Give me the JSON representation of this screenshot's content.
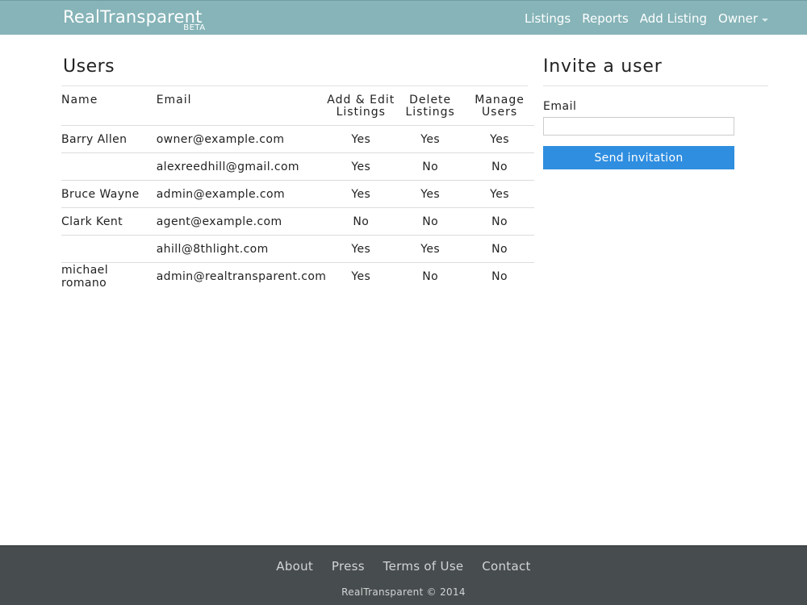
{
  "navbar": {
    "brand": "RealTransparent",
    "beta": "BETA",
    "links": [
      "Listings",
      "Reports",
      "Add Listing"
    ],
    "owner_menu": "Owner"
  },
  "users": {
    "title": "Users",
    "headers": {
      "name": "Name",
      "email": "Email",
      "add_edit_1": "Add & Edit",
      "add_edit_2": "Listings",
      "delete_1": "Delete",
      "delete_2": "Listings",
      "manage_1": "Manage",
      "manage_2": "Users"
    },
    "rows": [
      {
        "name": "Barry Allen",
        "email": "owner@example.com",
        "add_edit": "Yes",
        "delete": "Yes",
        "manage": "Yes"
      },
      {
        "name": "",
        "email": "alexreedhill@gmail.com",
        "add_edit": "Yes",
        "delete": "No",
        "manage": "No"
      },
      {
        "name": "Bruce Wayne",
        "email": "admin@example.com",
        "add_edit": "Yes",
        "delete": "Yes",
        "manage": "Yes"
      },
      {
        "name": "Clark Kent",
        "email": "agent@example.com",
        "add_edit": "No",
        "delete": "No",
        "manage": "No"
      },
      {
        "name": "",
        "email": "ahill@8thlight.com",
        "add_edit": "Yes",
        "delete": "Yes",
        "manage": "No"
      },
      {
        "name": "michael romano",
        "email": "admin@realtransparent.com",
        "add_edit": "Yes",
        "delete": "No",
        "manage": "No"
      }
    ]
  },
  "invite": {
    "title": "Invite a user",
    "email_label": "Email",
    "email_value": "",
    "send_label": "Send invitation"
  },
  "footer": {
    "links": [
      "About",
      "Press",
      "Terms of Use",
      "Contact"
    ],
    "copyright": "RealTransparent © 2014"
  },
  "colors": {
    "navbar": "#86b4b8",
    "button": "#2f8ee0",
    "footer": "#474c4e"
  }
}
